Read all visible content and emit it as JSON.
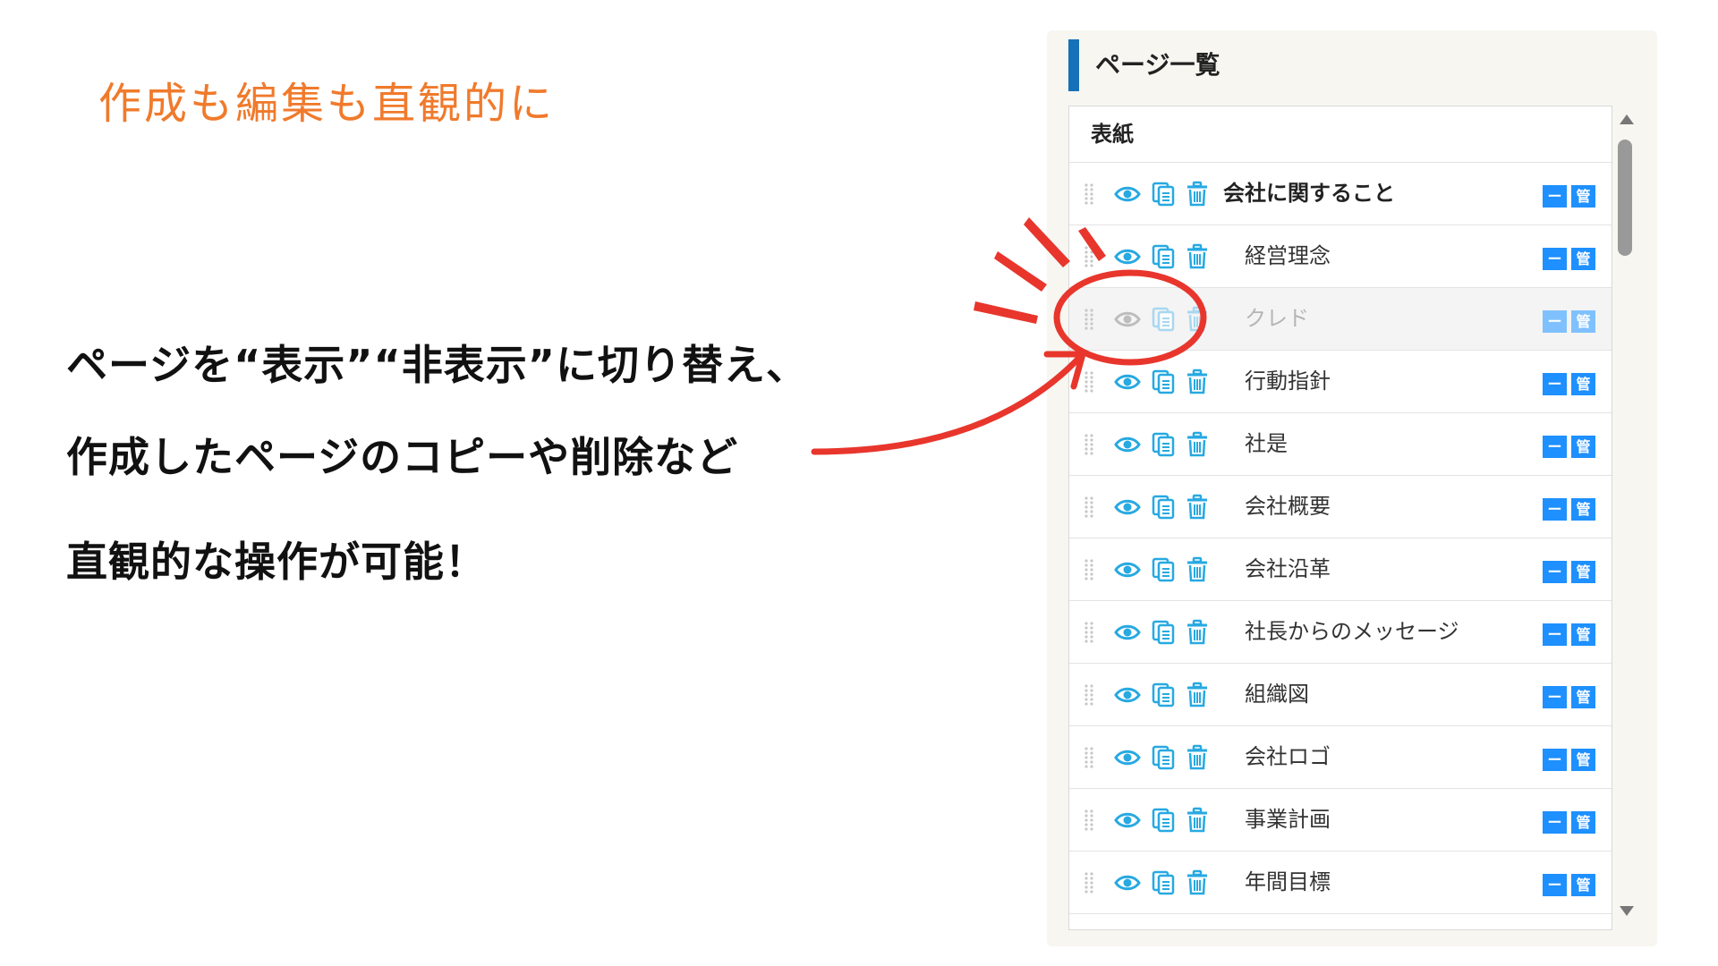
{
  "headline": "作成も編集も直観的に",
  "description": {
    "line1": "ページを“表示”“非表示”に切り替え、",
    "line2": "作成したページのコピーや削除など",
    "line3": "直観的な操作が可能！"
  },
  "panel": {
    "title": "ページ一覧",
    "cover_label": "表紙",
    "button_minus": "ー",
    "button_kan": "管",
    "rows": [
      {
        "label": "会社に関すること",
        "level": 1,
        "visible": true
      },
      {
        "label": "経営理念",
        "level": 2,
        "visible": true
      },
      {
        "label": "クレド",
        "level": 2,
        "visible": false
      },
      {
        "label": "行動指針",
        "level": 2,
        "visible": true
      },
      {
        "label": "社是",
        "level": 2,
        "visible": true
      },
      {
        "label": "会社概要",
        "level": 2,
        "visible": true
      },
      {
        "label": "会社沿革",
        "level": 2,
        "visible": true
      },
      {
        "label": "社長からのメッセージ",
        "level": 2,
        "visible": true
      },
      {
        "label": "組織図",
        "level": 2,
        "visible": true
      },
      {
        "label": "会社ロゴ",
        "level": 2,
        "visible": true
      },
      {
        "label": "事業計画",
        "level": 2,
        "visible": true
      },
      {
        "label": "年間目標",
        "level": 2,
        "visible": true
      }
    ]
  },
  "icons": {
    "eye": "eye-icon",
    "copy": "copy-icon",
    "trash": "trash-icon",
    "drag": "drag-handle-icon"
  },
  "colors": {
    "headline": "#f07a2c",
    "icon_blue": "#27a9e1",
    "button_blue": "#1e90ff",
    "title_bar": "#1671b8",
    "annotation_red": "#e8362d"
  }
}
